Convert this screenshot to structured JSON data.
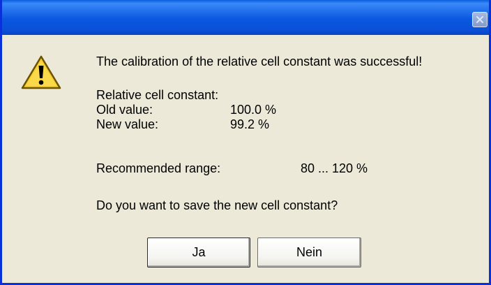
{
  "dialog": {
    "message": "The calibration of the relative cell constant was successful!",
    "icon": "warning-icon",
    "cell_constant_heading": "Relative cell constant:",
    "old_value_label": "Old value:",
    "old_value": "100.0 %",
    "new_value_label": "New value:",
    "new_value": "99.2 %",
    "recommended_range_label": "Recommended range:",
    "recommended_range": "80 ... 120 %",
    "question": "Do you want to save the new cell constant?"
  },
  "buttons": {
    "yes_label": "Ja",
    "no_label": "Nein"
  },
  "colors": {
    "titlebar": "#0a58e0",
    "dialog_background": "#ece9d8",
    "warning_yellow": "#f6d02a"
  }
}
